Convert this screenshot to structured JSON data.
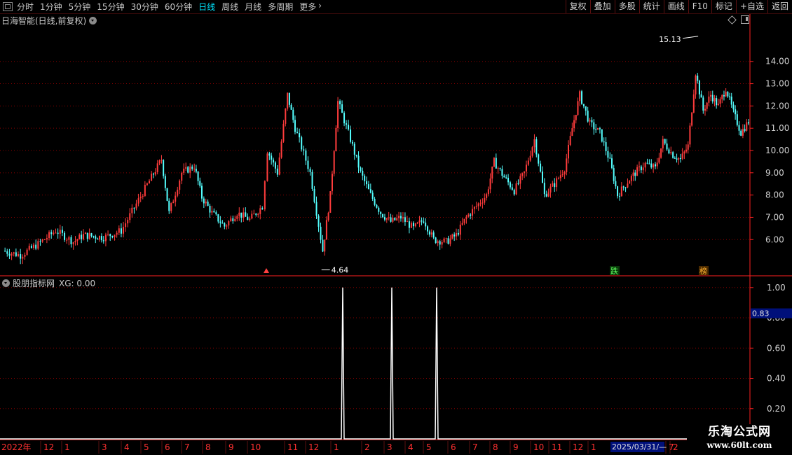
{
  "toolbar": {
    "timeframes": [
      "分时",
      "1分钟",
      "5分钟",
      "15分钟",
      "30分钟",
      "60分钟",
      "日线",
      "周线",
      "月线",
      "多周期",
      "更多"
    ],
    "active_timeframe": "日线",
    "more_arrow": "›",
    "buttons": [
      "复权",
      "叠加",
      "多股",
      "统计",
      "画线",
      "F10",
      "标记",
      "+自选",
      "返回"
    ]
  },
  "chart_title": "日海智能(日线,前复权)",
  "markers": {
    "high": "15.13",
    "low": "4.64",
    "signal_die": "跌",
    "signal_bang": "榜"
  },
  "indicator": {
    "name": "股朋指标网",
    "value_text": "XG: 0.00",
    "current_value": "0.83"
  },
  "date_box": "2025/03/31/—",
  "watermark": {
    "line1": "乐淘公式网",
    "line2": "www.60lt.com"
  },
  "colors": {
    "up": "#ff3c3c",
    "down": "#54ffff",
    "grid": "#8b0000",
    "axis": "#ff2020",
    "active": "#00e5ff",
    "signal": "#ffffff"
  },
  "chart_data": [
    {
      "type": "candlestick",
      "y_ticks": [
        "6.00",
        "7.00",
        "8.00",
        "9.00",
        "10.00",
        "11.00",
        "12.00",
        "13.00",
        "14.00"
      ],
      "ylim": [
        4.5,
        15.5
      ],
      "high": 15.13,
      "low": 4.64,
      "series": [
        {
          "x": 0.0,
          "c": 5.5
        },
        {
          "x": 0.7,
          "c": 5.3
        },
        {
          "x": 1.4,
          "c": 5.8
        },
        {
          "x": 2.1,
          "c": 6.4
        },
        {
          "x": 2.8,
          "c": 5.9
        },
        {
          "x": 3.2,
          "c": 6.2
        },
        {
          "x": 4.0,
          "c": 6.1
        },
        {
          "x": 4.7,
          "c": 6.4
        },
        {
          "x": 5.3,
          "c": 7.6
        },
        {
          "x": 5.9,
          "c": 8.8
        },
        {
          "x": 6.3,
          "c": 9.6
        },
        {
          "x": 6.6,
          "c": 7.2
        },
        {
          "x": 7.1,
          "c": 9.0
        },
        {
          "x": 7.6,
          "c": 9.3
        },
        {
          "x": 7.9,
          "c": 7.9
        },
        {
          "x": 8.3,
          "c": 7.2
        },
        {
          "x": 8.8,
          "c": 6.6
        },
        {
          "x": 9.3,
          "c": 7.2
        },
        {
          "x": 9.8,
          "c": 6.9
        },
        {
          "x": 10.3,
          "c": 7.5
        },
        {
          "x": 10.5,
          "c": 10.0
        },
        {
          "x": 10.9,
          "c": 9.0
        },
        {
          "x": 11.3,
          "c": 12.5
        },
        {
          "x": 11.6,
          "c": 11.0
        },
        {
          "x": 12.2,
          "c": 9.0
        },
        {
          "x": 12.7,
          "c": 5.5
        },
        {
          "x": 13.0,
          "c": 8.0
        },
        {
          "x": 13.3,
          "c": 12.2
        },
        {
          "x": 13.8,
          "c": 10.5
        },
        {
          "x": 14.2,
          "c": 9.0
        },
        {
          "x": 14.6,
          "c": 8.0
        },
        {
          "x": 15.0,
          "c": 7.2
        },
        {
          "x": 15.4,
          "c": 6.8
        },
        {
          "x": 15.8,
          "c": 7.0
        },
        {
          "x": 16.3,
          "c": 6.5
        },
        {
          "x": 16.7,
          "c": 6.9
        },
        {
          "x": 17.1,
          "c": 6.0
        },
        {
          "x": 17.6,
          "c": 5.9
        },
        {
          "x": 18.0,
          "c": 6.2
        },
        {
          "x": 18.4,
          "c": 7.0
        },
        {
          "x": 18.8,
          "c": 7.5
        },
        {
          "x": 19.2,
          "c": 8.0
        },
        {
          "x": 19.5,
          "c": 9.5
        },
        {
          "x": 19.9,
          "c": 8.8
        },
        {
          "x": 20.3,
          "c": 8.2
        },
        {
          "x": 20.7,
          "c": 9.0
        },
        {
          "x": 21.1,
          "c": 10.5
        },
        {
          "x": 21.5,
          "c": 8.0
        },
        {
          "x": 21.9,
          "c": 8.5
        },
        {
          "x": 22.3,
          "c": 9.2
        },
        {
          "x": 22.6,
          "c": 11.0
        },
        {
          "x": 22.9,
          "c": 12.5
        },
        {
          "x": 23.3,
          "c": 11.2
        },
        {
          "x": 23.7,
          "c": 10.8
        },
        {
          "x": 24.1,
          "c": 9.5
        },
        {
          "x": 24.4,
          "c": 8.0
        },
        {
          "x": 24.8,
          "c": 8.6
        },
        {
          "x": 25.1,
          "c": 9.0
        },
        {
          "x": 25.5,
          "c": 9.4
        },
        {
          "x": 25.9,
          "c": 9.2
        },
        {
          "x": 26.2,
          "c": 10.4
        },
        {
          "x": 26.6,
          "c": 9.8
        },
        {
          "x": 26.9,
          "c": 9.6
        },
        {
          "x": 27.2,
          "c": 10.2
        },
        {
          "x": 27.5,
          "c": 13.5
        },
        {
          "x": 27.8,
          "c": 11.8
        },
        {
          "x": 28.1,
          "c": 12.5
        },
        {
          "x": 28.4,
          "c": 12.0
        },
        {
          "x": 28.7,
          "c": 12.8
        },
        {
          "x": 29.0,
          "c": 11.7
        },
        {
          "x": 29.3,
          "c": 10.8
        },
        {
          "x": 29.6,
          "c": 11.3
        }
      ]
    },
    {
      "type": "line",
      "y_ticks": [
        "0.20",
        "0.40",
        "0.60",
        "0.80",
        "1.00"
      ],
      "ylim": [
        0,
        1.05
      ],
      "spikes_at_index": [
        16,
        19,
        22
      ],
      "values_baseline": 0.0,
      "spike_value": 1.0
    }
  ],
  "date_axis": [
    "2022年",
    "12",
    "1",
    "3",
    "4",
    "5",
    "6",
    "7",
    "8",
    "9",
    "10",
    "11",
    "12",
    "1",
    "2",
    "3",
    "4",
    "5",
    "6",
    "7",
    "8",
    "9",
    "10",
    "11",
    "12",
    "1",
    "2",
    "3",
    "7"
  ]
}
